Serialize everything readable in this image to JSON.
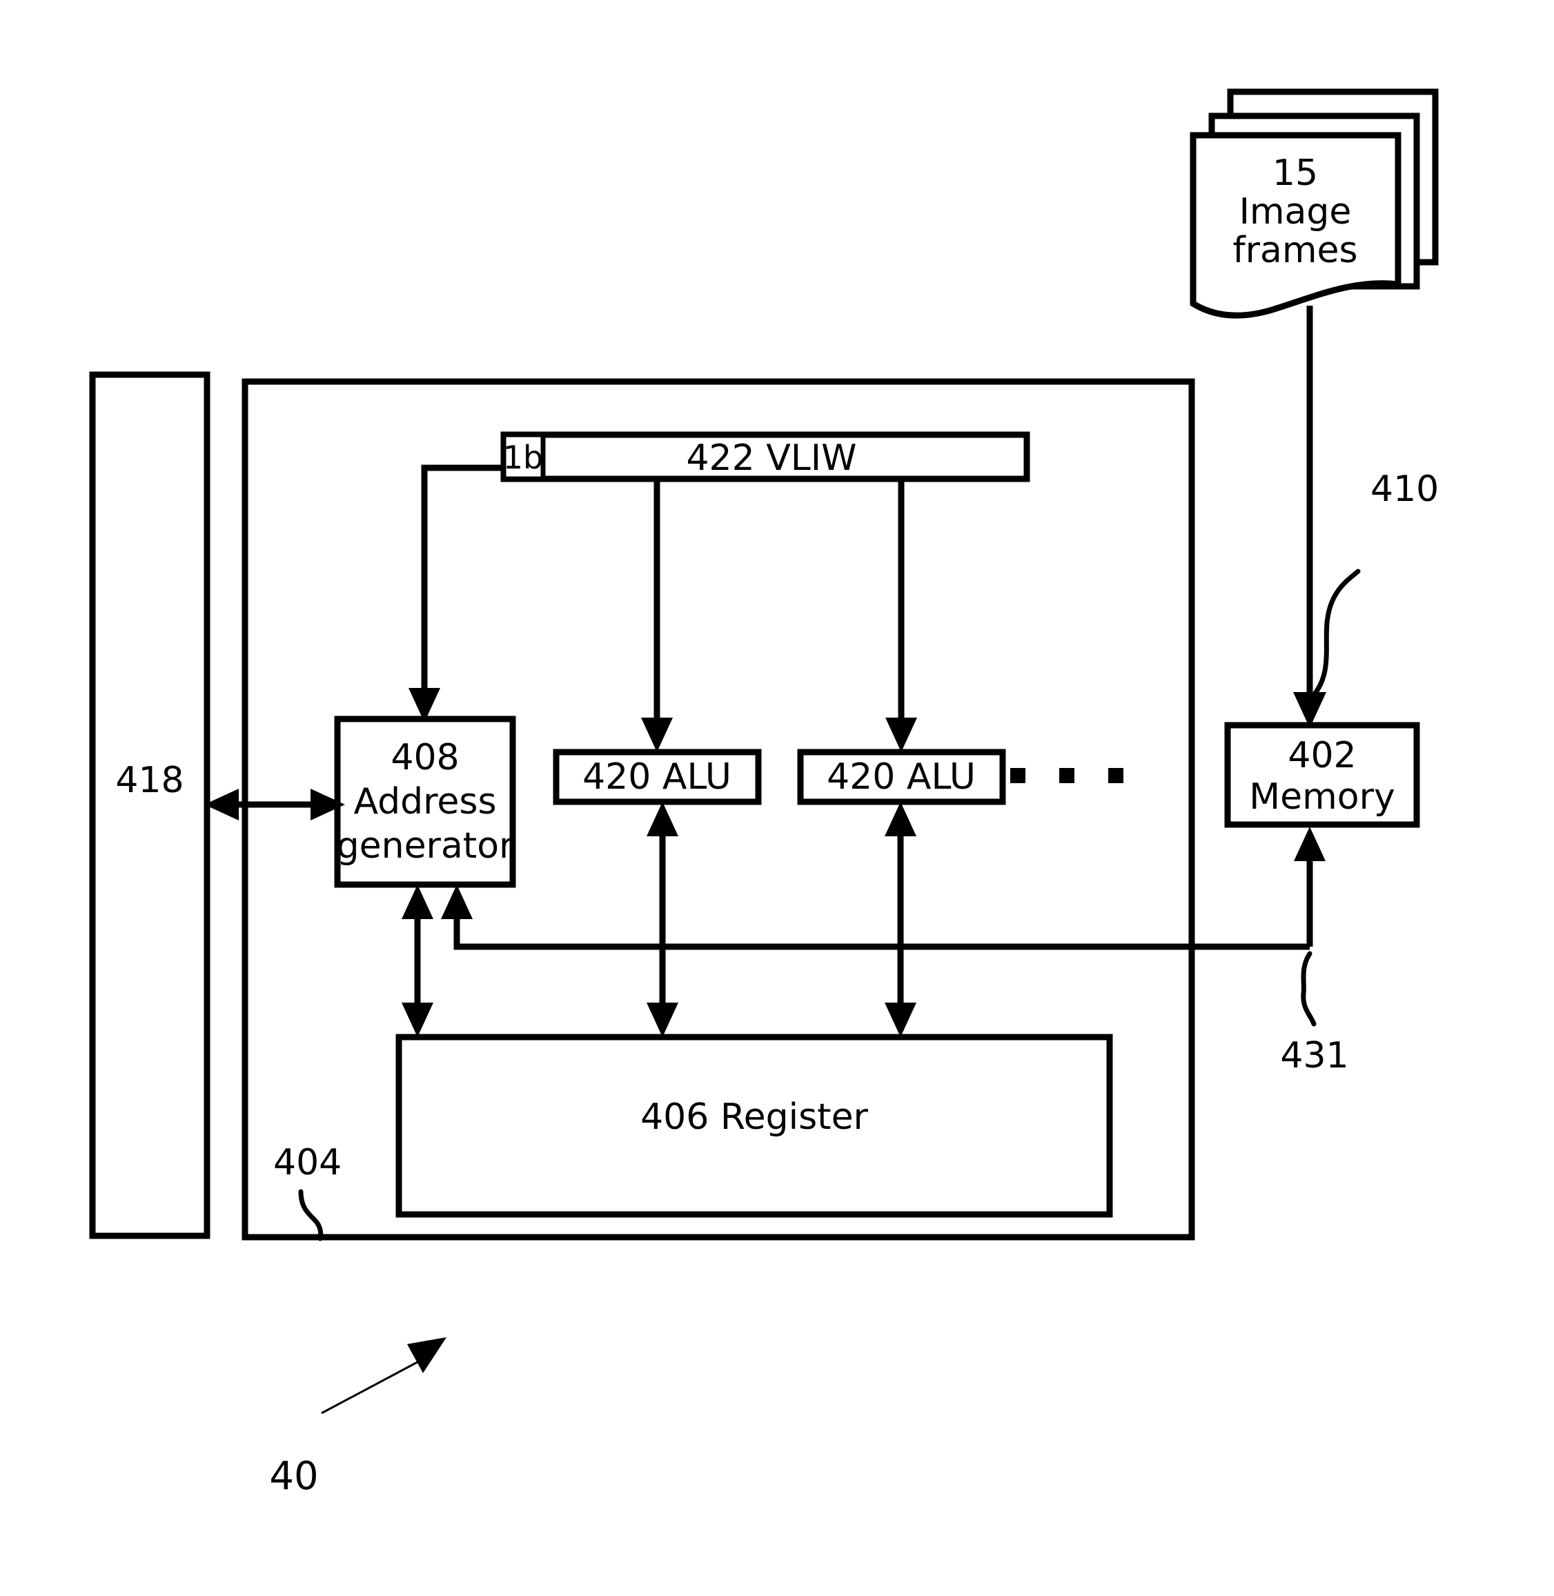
{
  "figure": {
    "number": "40",
    "caption_number": "40"
  },
  "blocks": {
    "image_frames": {
      "ref": "15",
      "line1": "15",
      "line2": "Image",
      "line3": "frames",
      "full_label": "15 Image frames"
    },
    "memory": {
      "ref": "402",
      "line1": "402",
      "line2": "Memory",
      "full_label": "402 Memory"
    },
    "processor": {
      "ref": "404",
      "full_label": "404"
    },
    "register": {
      "ref": "406",
      "full_label": "406 Register"
    },
    "address_generator": {
      "ref": "408",
      "line1": "408",
      "line2": "Address",
      "line3": "generator",
      "full_label": "408 Address generator"
    },
    "vliw": {
      "ref": "422",
      "full_label": "422 VLIW",
      "field_label": "1b"
    },
    "alu_left": {
      "ref": "420",
      "full_label": "420 ALU"
    },
    "alu_right": {
      "ref": "420",
      "full_label": "420 ALU"
    },
    "external_unit": {
      "ref": "418",
      "full_label": "418"
    }
  },
  "connections": {
    "image_to_memory": {
      "ref": "410",
      "label": "410"
    },
    "register_to_memory_bus": {
      "ref": "431",
      "label": "431"
    }
  },
  "ellipsis": {
    "label": "dots",
    "count": 3
  },
  "colors": {
    "line": "#000000",
    "fill": "#ffffff",
    "text": "#000000"
  }
}
